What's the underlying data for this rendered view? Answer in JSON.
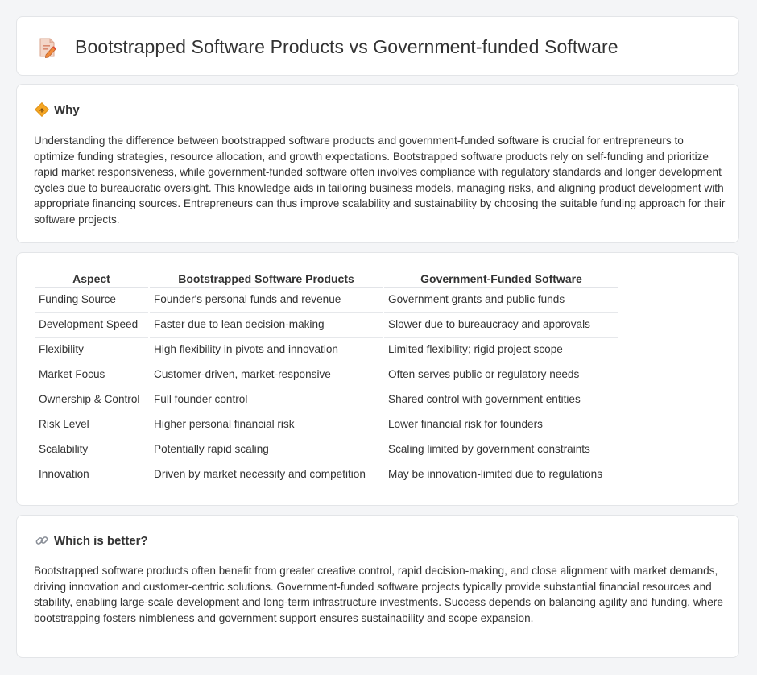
{
  "header": {
    "title": "Bootstrapped Software Products vs Government-funded Software"
  },
  "why": {
    "title": "Why",
    "body": "Understanding the difference between bootstrapped software products and government-funded software is crucial for entrepreneurs to optimize funding strategies, resource allocation, and growth expectations. Bootstrapped software products rely on self-funding and prioritize rapid market responsiveness, while government-funded software often involves compliance with regulatory standards and longer development cycles due to bureaucratic oversight. This knowledge aids in tailoring business models, managing risks, and aligning product development with appropriate financing sources. Entrepreneurs can thus improve scalability and sustainability by choosing the suitable funding approach for their software projects."
  },
  "comparison": {
    "headers": [
      "Aspect",
      "Bootstrapped Software Products",
      "Government-Funded Software"
    ],
    "rows": [
      [
        "Funding Source",
        "Founder's personal funds and revenue",
        "Government grants and public funds"
      ],
      [
        "Development Speed",
        "Faster due to lean decision-making",
        "Slower due to bureaucracy and approvals"
      ],
      [
        "Flexibility",
        "High flexibility in pivots and innovation",
        "Limited flexibility; rigid project scope"
      ],
      [
        "Market Focus",
        "Customer-driven, market-responsive",
        "Often serves public or regulatory needs"
      ],
      [
        "Ownership & Control",
        "Full founder control",
        "Shared control with government entities"
      ],
      [
        "Risk Level",
        "Higher personal financial risk",
        "Lower financial risk for founders"
      ],
      [
        "Scalability",
        "Potentially rapid scaling",
        "Scaling limited by government constraints"
      ],
      [
        "Innovation",
        "Driven by market necessity and competition",
        "May be innovation-limited due to regulations"
      ]
    ]
  },
  "better": {
    "title": "Which is better?",
    "body": "Bootstrapped software products often benefit from greater creative control, rapid decision-making, and close alignment with market demands, driving innovation and customer-centric solutions. Government-funded software projects typically provide substantial financial resources and stability, enabling large-scale development and long-term infrastructure investments. Success depends on balancing agility and funding, where bootstrapping fosters nimbleness and government support ensures sustainability and scope expansion."
  },
  "icons": {
    "title": "document-pencil-icon",
    "why": "diamond-sign-icon",
    "better": "link-icon"
  },
  "colors": {
    "background": "#f4f5f7",
    "card": "#ffffff",
    "text": "#333333",
    "accent_orange": "#f5a623",
    "accent_red": "#e0533d"
  }
}
